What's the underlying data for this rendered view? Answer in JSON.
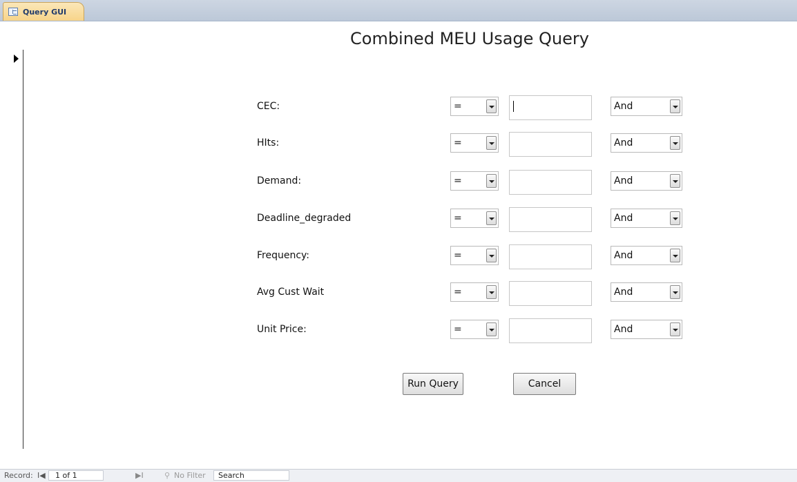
{
  "tab": {
    "title": "Query GUI",
    "icon": "form-icon"
  },
  "form": {
    "title": "Combined MEU Usage Query",
    "fields": [
      {
        "label": "CEC:",
        "operator": "=",
        "value": "",
        "logic": "And"
      },
      {
        "label": "HIts:",
        "operator": "=",
        "value": "",
        "logic": "And"
      },
      {
        "label": "Demand:",
        "operator": "=",
        "value": "",
        "logic": "And"
      },
      {
        "label": "Deadline_degraded",
        "operator": "=",
        "value": "",
        "logic": "And"
      },
      {
        "label": "Frequency:",
        "operator": "=",
        "value": "",
        "logic": "And"
      },
      {
        "label": "Avg Cust Wait",
        "operator": "=",
        "value": "",
        "logic": "And"
      },
      {
        "label": "Unit Price:",
        "operator": "=",
        "value": "",
        "logic": "And"
      }
    ],
    "run_label": "Run Query",
    "cancel_label": "Cancel"
  },
  "statusbar": {
    "record_label": "Record:",
    "first": "I◀",
    "position": "1 of 1",
    "last": "▶I",
    "filter_icon": "funnel-icon",
    "filter_label": "No Filter",
    "search_label": "Search"
  }
}
